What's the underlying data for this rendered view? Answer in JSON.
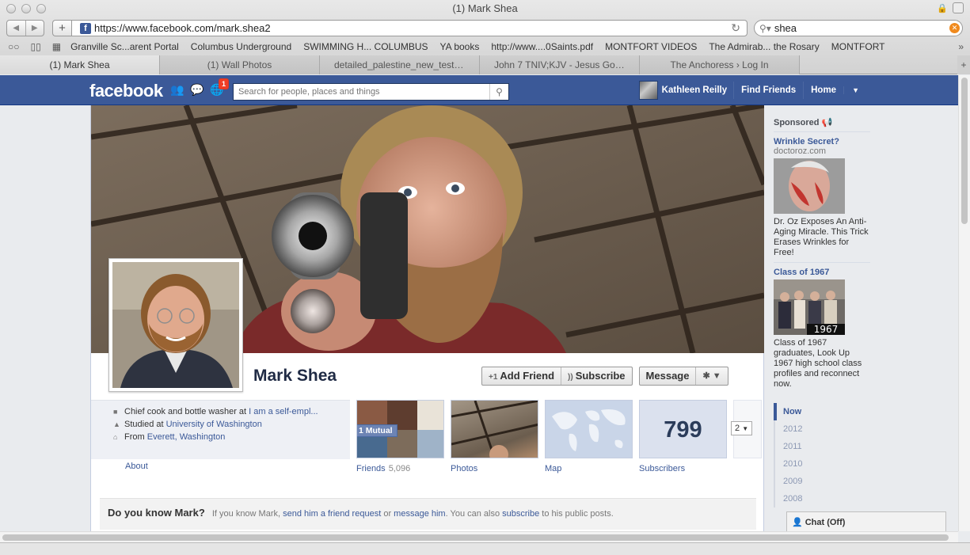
{
  "window": {
    "title": "(1) Mark Shea"
  },
  "browser": {
    "url": "https://www.facebook.com/mark.shea2",
    "search_value": "shea",
    "bookmarks": [
      "Granville Sc...arent Portal",
      "Columbus Underground",
      "SWIMMING H... COLUMBUS",
      "YA books",
      "http://www....0Saints.pdf",
      "MONTFORT VIDEOS",
      "The Admirab... the Rosary",
      "MONTFORT"
    ],
    "tabs": [
      "(1) Mark Shea",
      "(1) Wall Photos",
      "detailed_palestine_new_testam...",
      "John 7 TNIV;KJV - Jesus Goes t...",
      "The Anchoress › Log In"
    ]
  },
  "fb": {
    "logo": "facebook",
    "notification_count": "1",
    "search_placeholder": "Search for people, places and things",
    "user_name": "Kathleen Reilly",
    "find_friends": "Find Friends",
    "home": "Home"
  },
  "profile": {
    "name": "Mark Shea",
    "add_friend": "Add Friend",
    "subscribe": "Subscribe",
    "message": "Message",
    "info": {
      "work_prefix": "Chief cook and bottle washer at ",
      "work_link": "I am a self-empl...",
      "study_prefix": "Studied at ",
      "study_link": "University of Washington",
      "from_prefix": "From ",
      "from_link": "Everett, Washington"
    },
    "about": "About",
    "mutual_badge": "1 Mutual",
    "friends_label": "Friends",
    "friends_count": "5,096",
    "photos_label": "Photos",
    "map_label": "Map",
    "subscribers_count": "799",
    "subscribers_label": "Subscribers",
    "more_select": "2"
  },
  "know_bar": {
    "heading": "Do you know Mark?",
    "text1": "If you know Mark, ",
    "link1": "send him a friend request",
    "text2": " or ",
    "link2": "message him",
    "text3": ". You can also ",
    "link3": "subscribe",
    "text4": " to his public posts."
  },
  "sponsored": {
    "label": "Sponsored",
    "ads": [
      {
        "title": "Wrinkle Secret?",
        "domain": "doctoroz.com",
        "body": "Dr. Oz Exposes An Anti-Aging Miracle. This Trick Erases Wrinkles for Free!"
      },
      {
        "title": "Class of 1967",
        "domain": "",
        "image_text": "1967",
        "body": "Class of 1967 graduates, Look Up 1967 high school class profiles and reconnect now."
      }
    ]
  },
  "years": [
    "Now",
    "2012",
    "2011",
    "2010",
    "2009",
    "2008"
  ],
  "chat": {
    "label": "Chat (Off)"
  },
  "icons": [
    "friends-jewel-icon",
    "messages-jewel-icon",
    "notifications-jewel-icon",
    "search-icon",
    "gear-icon",
    "briefcase-icon",
    "graduation-icon",
    "home-icon",
    "chat-icon"
  ],
  "colors": {
    "fb_blue": "#3b5998",
    "notification_red": "#f03d25"
  }
}
